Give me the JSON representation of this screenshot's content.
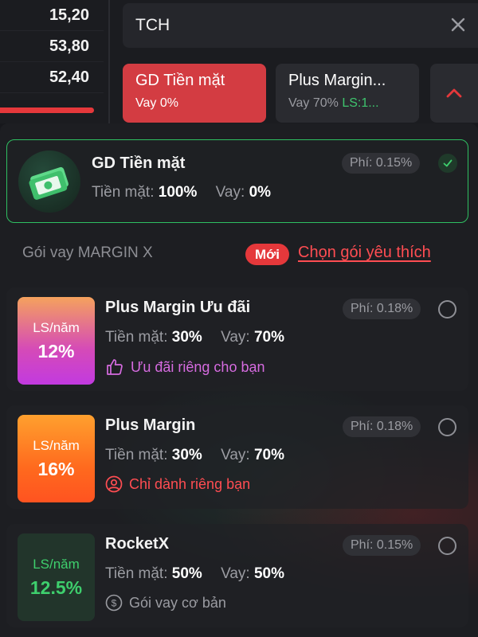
{
  "prices": [
    "15,20",
    "53,80",
    "52,40"
  ],
  "search": {
    "value": "TCH"
  },
  "tabs": {
    "cash": {
      "title": "GD Tiền mặt",
      "sub": "Vay 0%"
    },
    "margin": {
      "title": "Plus Margin...",
      "sub_loan": "Vay 70%",
      "sub_rate": "LS:1..."
    }
  },
  "cash_package": {
    "title": "GD Tiền mặt",
    "fee": "Phí: 0.15%",
    "cash_label": "Tiền mặt:",
    "cash_value": "100%",
    "loan_label": "Vay:",
    "loan_value": "0%"
  },
  "section": {
    "title": "Gói vay MARGIN X",
    "new_badge": "Mới",
    "favorite_link": "Chọn gói yêu thích"
  },
  "packages": [
    {
      "name": "Plus Margin Ưu đãi",
      "rate_label": "LS/năm",
      "rate": "12%",
      "fee": "Phí: 0.18%",
      "cash_label": "Tiền mặt:",
      "cash_value": "30%",
      "loan_label": "Vay:",
      "loan_value": "70%",
      "note": "Ưu đãi riêng cho bạn",
      "note_icon": "thumbs-up-icon"
    },
    {
      "name": "Plus Margin",
      "rate_label": "LS/năm",
      "rate": "16%",
      "fee": "Phí: 0.18%",
      "cash_label": "Tiền mặt:",
      "cash_value": "30%",
      "loan_label": "Vay:",
      "loan_value": "70%",
      "note": "Chỉ dành riêng bạn",
      "note_icon": "user-circle-icon"
    },
    {
      "name": "RocketX",
      "rate_label": "LS/năm",
      "rate": "12.5%",
      "fee": "Phí: 0.15%",
      "cash_label": "Tiền mặt:",
      "cash_value": "50%",
      "loan_label": "Vay:",
      "loan_value": "50%",
      "note": "Gói vay cơ bản",
      "note_icon": "dollar-circle-icon"
    }
  ],
  "colors": {
    "accent_red": "#e5383b",
    "accent_green": "#2fbf62",
    "note_purple": "#d66be0",
    "note_red": "#ff4d52",
    "note_gray": "#9b9ca2"
  }
}
